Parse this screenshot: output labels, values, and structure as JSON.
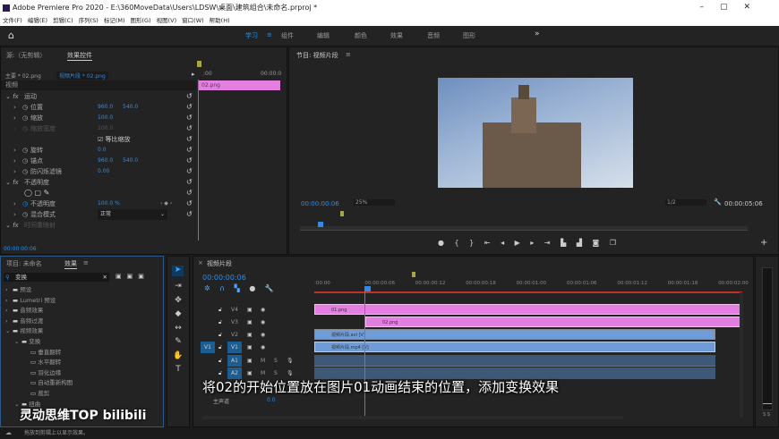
{
  "window": {
    "title": "Adobe Premiere Pro 2020 - E:\\360MoveData\\Users\\LDSW\\桌面\\建筑组合\\未命名.prproj *"
  },
  "menu": [
    "文件(F)",
    "编辑(E)",
    "剪辑(C)",
    "序列(S)",
    "标记(M)",
    "图形(G)",
    "视图(V)",
    "窗口(W)",
    "帮助(H)"
  ],
  "workspaces": [
    "学习",
    "组件",
    "编辑",
    "颜色",
    "效果",
    "音频",
    "图形"
  ],
  "workspace_more": "»",
  "effect_controls": {
    "tabs": [
      "源:（无剪辑）",
      "效果控件"
    ],
    "master": "主要 * 02.png",
    "clip": "视频片段 * 02.png",
    "time_start": ":00",
    "time_end": "00:00:0",
    "clip_label": "02.png",
    "section": "视频",
    "rows": [
      {
        "label": "运动",
        "fx": true
      },
      {
        "label": "位置",
        "v1": "960.0",
        "v2": "540.0"
      },
      {
        "label": "缩放",
        "v1": "100.0"
      },
      {
        "label": "缩放宽度",
        "v1": "100.0",
        "disabled": true
      },
      {
        "label": "等比缩放",
        "checkbox": true
      },
      {
        "label": "旋转",
        "v1": "0.0"
      },
      {
        "label": "锚点",
        "v1": "960.0",
        "v2": "540.0"
      },
      {
        "label": "防闪烁滤镜",
        "v1": "0.00"
      },
      {
        "label": "不透明度",
        "fx": true
      },
      {
        "label": "",
        "masks": true
      },
      {
        "label": "不透明度",
        "v1": "100.0 %"
      },
      {
        "label": "混合模式",
        "v1": "正常",
        "dropdown": true
      },
      {
        "label": "时间重映射",
        "fx": true,
        "disabled": true
      }
    ],
    "timecode": "00:00:00:06"
  },
  "program": {
    "title": "节目: 视频片段",
    "timecode": "00:00:00:06",
    "zoom": "25%",
    "resolution": "1/2",
    "duration": "00:00:05:06"
  },
  "effects_panel": {
    "tabs": [
      "项目: 未命名",
      "效果"
    ],
    "search": "变换",
    "tree": [
      {
        "label": "预设",
        "level": 0
      },
      {
        "label": "Lumetri 预设",
        "level": 0
      },
      {
        "label": "音频效果",
        "level": 0
      },
      {
        "label": "音频过渡",
        "level": 0
      },
      {
        "label": "视频效果",
        "level": 0,
        "open": true
      },
      {
        "label": "变换",
        "level": 1,
        "open": true
      },
      {
        "label": "垂直翻转",
        "level": 2
      },
      {
        "label": "水平翻转",
        "level": 2
      },
      {
        "label": "羽化边缘",
        "level": 2
      },
      {
        "label": "自动重新构图",
        "level": 2
      },
      {
        "label": "裁剪",
        "level": 2
      },
      {
        "label": "扭曲",
        "level": 1,
        "open": true
      }
    ]
  },
  "timeline": {
    "title": "视频片段",
    "timecode": "00:00:00:06",
    "ruler": [
      ":00:00",
      "00:00:00:06",
      "00:00:00:12",
      "00:00:00:18",
      "00:00:01:00",
      "00:00:01:06",
      "00:00:01:12",
      "00:00:01:18",
      "00:00:02:00"
    ],
    "tracks": [
      "V4",
      "V3",
      "V2",
      "V1",
      "A1",
      "A2"
    ],
    "source_patch": "V1",
    "master": {
      "label": "主声道",
      "value": "0.0"
    },
    "clips": [
      {
        "name": "01.png"
      },
      {
        "name": "02.png"
      },
      {
        "name": "视频片段.avi [V]"
      },
      {
        "name": "视频片段.mp4 [V]"
      }
    ],
    "meter_labels": "S S"
  },
  "subtitle": "将02的开始位置放在图片01动画结束的位置，添加变换效果",
  "watermark": "灵动思维TOP bilibili",
  "status": "拖放到剪辑上以显示效果。",
  "colors": {
    "accent": "#2d8ceb",
    "clip_graphic": "#e37fe0",
    "clip_video": "#6f9bd6",
    "clip_audio": "#3d5878",
    "work_area": "#c0302a"
  }
}
